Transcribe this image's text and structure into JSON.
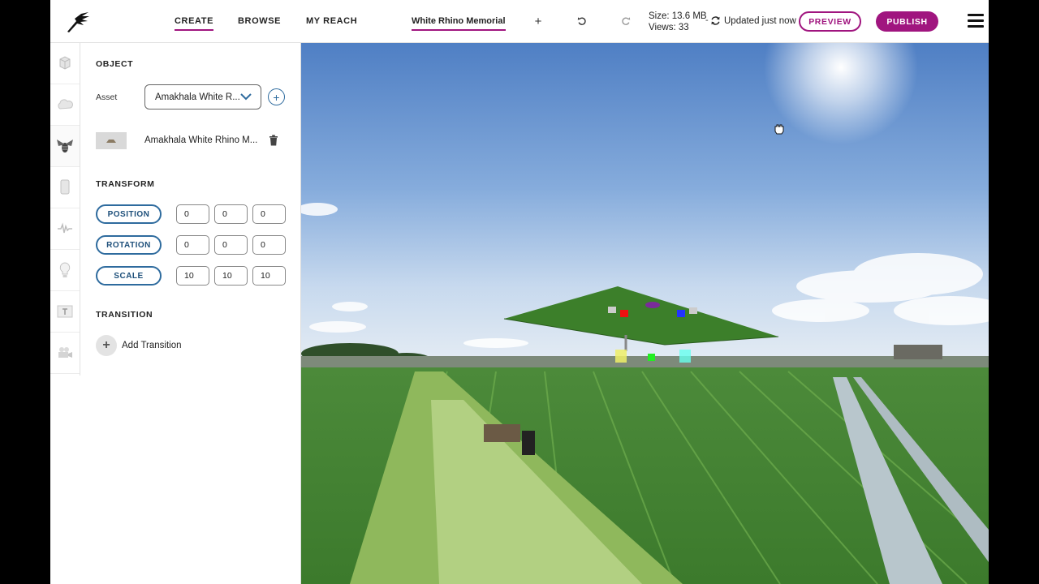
{
  "nav": {
    "create": "CREATE",
    "browse": "BROWSE",
    "my_reach": "MY REACH"
  },
  "project": {
    "title": "White Rhino Memorial",
    "size": "Size: 13.6 MB",
    "views": "Views: 33",
    "separator": "-",
    "updated": "Updated just now"
  },
  "actions": {
    "add": "+",
    "preview": "PREVIEW",
    "publish": "PUBLISH"
  },
  "rail": {
    "items": [
      "cube-icon",
      "cloud-icon",
      "bee-icon",
      "phone-icon",
      "waveform-icon",
      "lightbulb-icon",
      "text-icon",
      "video-camera-icon"
    ],
    "active_index": 2
  },
  "panel": {
    "object_title": "OBJECT",
    "asset_label": "Asset",
    "asset_selected": "Amakhala White R...",
    "asset_item": "Amakhala White Rhino M...",
    "transform_title": "TRANSFORM",
    "position_label": "POSITION",
    "rotation_label": "ROTATION",
    "scale_label": "SCALE",
    "position": [
      "0",
      "0",
      "0"
    ],
    "rotation": [
      "0",
      "0",
      "0"
    ],
    "scale": [
      "10",
      "10",
      "10"
    ],
    "transition_title": "TRANSITION",
    "add_transition": "Add Transition"
  },
  "colors": {
    "accent": "#a0157f",
    "blue": "#2e6b9e"
  }
}
